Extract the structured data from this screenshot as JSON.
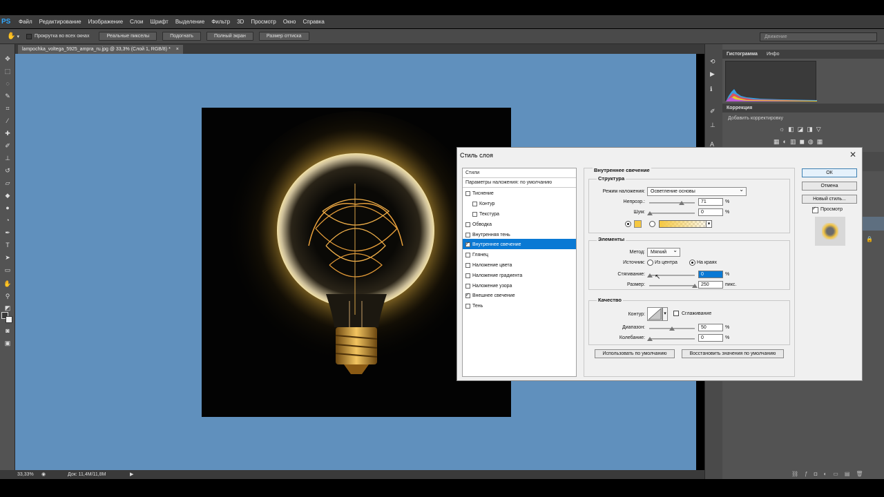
{
  "app": {
    "logo": "PS"
  },
  "menu": [
    "Файл",
    "Редактирование",
    "Изображение",
    "Слои",
    "Шрифт",
    "Выделение",
    "Фильтр",
    "3D",
    "Просмотр",
    "Окно",
    "Справка"
  ],
  "options_bar": {
    "scroll_all_label": "Прокрутка во всех окнах",
    "buttons": [
      "Реальные пикселы",
      "Подогнать",
      "Полный экран",
      "Размер оттиска"
    ],
    "workspace": "Движение"
  },
  "document_tab": {
    "title": "lampochka_voltega_5925_ampra_ru.jpg @ 33,3% (Слой 1, RGB/8) *",
    "close": "×"
  },
  "status_bar": {
    "zoom": "33,33%",
    "doc_info": "Док: 11,4M/11,8M"
  },
  "right_panels": {
    "tabs_top": [
      "Гистограмма",
      "Инфо"
    ],
    "correction_tab": "Коррекция",
    "correction_hint": "Добавить корректировку",
    "warning": "⚠"
  },
  "dialog": {
    "title": "Стиль слоя",
    "close": "✕",
    "styles_header": "Стили",
    "blending_default": "Параметры наложения: по умолчанию",
    "style_items": [
      {
        "label": "Тиснение",
        "checked": false,
        "indent": false,
        "selected": false
      },
      {
        "label": "Контур",
        "checked": false,
        "indent": true,
        "selected": false
      },
      {
        "label": "Текстура",
        "checked": false,
        "indent": true,
        "selected": false
      },
      {
        "label": "Обводка",
        "checked": false,
        "indent": false,
        "selected": false
      },
      {
        "label": "Внутренняя тень",
        "checked": false,
        "indent": false,
        "selected": false
      },
      {
        "label": "Внутреннее свечение",
        "checked": true,
        "indent": false,
        "selected": true
      },
      {
        "label": "Глянец",
        "checked": false,
        "indent": false,
        "selected": false
      },
      {
        "label": "Наложение цвета",
        "checked": false,
        "indent": false,
        "selected": false
      },
      {
        "label": "Наложение градиента",
        "checked": false,
        "indent": false,
        "selected": false
      },
      {
        "label": "Наложение узора",
        "checked": false,
        "indent": false,
        "selected": false
      },
      {
        "label": "Внешнее свечение",
        "checked": true,
        "indent": false,
        "selected": false
      },
      {
        "label": "Тень",
        "checked": false,
        "indent": false,
        "selected": false
      }
    ],
    "section_title": "Внутреннее свечение",
    "structure": {
      "title": "Структура",
      "blend_mode_label": "Режим наложения:",
      "blend_mode_value": "Осветление основы",
      "opacity_label": "Непрозр.:",
      "opacity_value": "71",
      "opacity_fraction": 0.71,
      "noise_label": "Шум:",
      "noise_value": "0",
      "percent": "%",
      "glow_color": "#f5c842"
    },
    "elements": {
      "title": "Элементы",
      "method_label": "Метод:",
      "method_value": "Мягкий",
      "source_label": "Источник:",
      "source_center": "Из центра",
      "source_edge": "На краях",
      "choke_label": "Стягивание:",
      "choke_value": "0",
      "size_label": "Размер:",
      "size_value": "250",
      "size_unit": "пикс.",
      "size_fraction": 1.0
    },
    "quality": {
      "title": "Качество",
      "contour_label": "Контур:",
      "antialias_label": "Сглаживание",
      "range_label": "Диапазон:",
      "range_value": "50",
      "range_fraction": 0.5,
      "jitter_label": "Колебание:",
      "jitter_value": "0"
    },
    "default_button": "Использовать по умолчанию",
    "reset_button": "Восстановить значения по умолчанию",
    "ok_button": "ОК",
    "cancel_button": "Отмена",
    "new_style_button": "Новый стиль...",
    "preview_label": "Просмотр",
    "preview_checked": true
  },
  "colors": {
    "canvas_bg": "#6090bd",
    "selection": "#0a79d4",
    "glow": "#f5c842"
  }
}
